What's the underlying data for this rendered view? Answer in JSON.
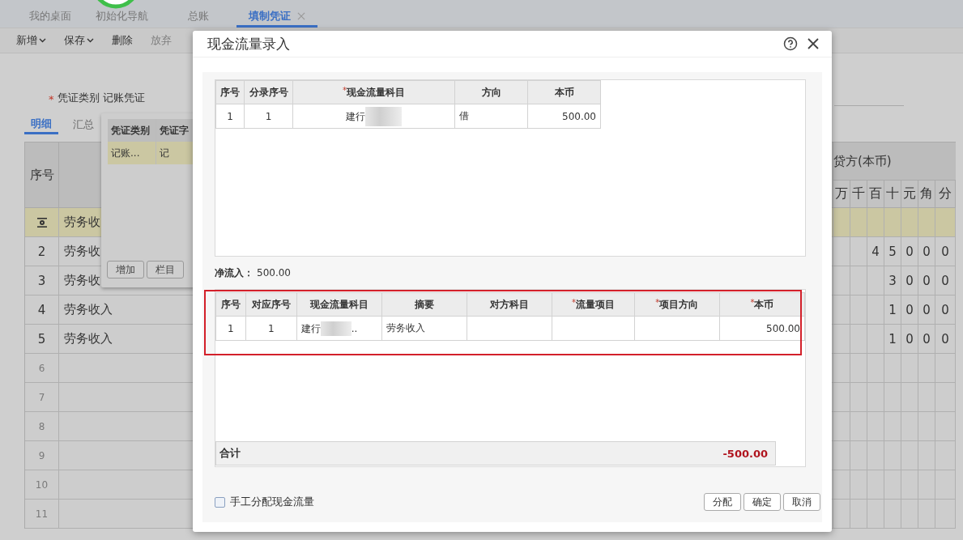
{
  "page_tabs": [
    {
      "label": "我的桌面",
      "selected": false,
      "closable": false
    },
    {
      "label": "初始化导航",
      "selected": false,
      "closable": false
    },
    {
      "label": "总账",
      "selected": false,
      "closable": false
    },
    {
      "label": "填制凭证",
      "selected": true,
      "closable": true
    }
  ],
  "toolbar": [
    {
      "label": "新增",
      "dropdown": true,
      "disabled": false
    },
    {
      "label": "保存",
      "dropdown": true,
      "disabled": false
    },
    {
      "label": "删除",
      "dropdown": false,
      "disabled": false
    },
    {
      "label": "放弃",
      "dropdown": false,
      "disabled": true
    }
  ],
  "voucher_type": {
    "mark": "*",
    "label": "凭证类别",
    "value": "记账凭证"
  },
  "detail_tabs": [
    {
      "label": "明细",
      "selected": true
    },
    {
      "label": "汇总",
      "selected": false
    }
  ],
  "voucher_table": {
    "columns": {
      "seq": "序号",
      "credit": "贷方(本币)",
      "digits": [
        "万",
        "千",
        "百",
        "十",
        "元",
        "角",
        "分"
      ]
    },
    "rows": [
      {
        "kind": "current",
        "summary": "劳务收",
        "selected": true,
        "empty": false
      },
      {
        "kind": "numbered",
        "seq": "2",
        "summary": "劳务收",
        "credit": [
          "4",
          "5",
          "0",
          "0",
          "0"
        ],
        "selected": false,
        "empty": false
      },
      {
        "kind": "numbered",
        "seq": "3",
        "summary": "劳务收",
        "credit": [
          "3",
          "0",
          "0",
          "0"
        ],
        "selected": false,
        "empty": false
      },
      {
        "kind": "numbered",
        "seq": "4",
        "summary": "劳务收入",
        "credit": [
          "1",
          "0",
          "0",
          "0"
        ],
        "selected": false,
        "empty": false
      },
      {
        "kind": "numbered",
        "seq": "5",
        "summary": "劳务收入",
        "credit": [
          "1",
          "0",
          "0",
          "0"
        ],
        "selected": false,
        "empty": false
      },
      {
        "kind": "numbered",
        "seq": "6",
        "selected": false,
        "empty": true
      },
      {
        "kind": "numbered",
        "seq": "7",
        "selected": false,
        "empty": true
      },
      {
        "kind": "numbered",
        "seq": "8",
        "selected": false,
        "empty": true
      },
      {
        "kind": "numbered",
        "seq": "9",
        "selected": false,
        "empty": true
      },
      {
        "kind": "numbered",
        "seq": "10",
        "selected": false,
        "empty": true
      },
      {
        "kind": "numbered",
        "seq": "11",
        "selected": false,
        "empty": true
      }
    ]
  },
  "type_popup": {
    "columns": [
      "凭证类别",
      "凭证字"
    ],
    "rows": [
      {
        "cells": [
          "记账...",
          "记"
        ],
        "selected": true
      }
    ],
    "buttons": [
      "增加",
      "栏目"
    ]
  },
  "dialog": {
    "title": "现金流量录入",
    "upper_table": {
      "columns": [
        {
          "label": "序号"
        },
        {
          "label": "分录序号"
        },
        {
          "mark": "*",
          "label": "现金流量科目"
        },
        {
          "label": "方向"
        },
        {
          "label": "本币"
        }
      ],
      "rows": [
        {
          "seq": "1",
          "entry_seq": "1",
          "account": {
            "text": "建行",
            "redacted": true
          },
          "direction": "借",
          "amount": "500.00"
        }
      ]
    },
    "net_inflow": {
      "label": "净流入：",
      "value": "500.00"
    },
    "lower_table": {
      "columns": [
        {
          "label": "序号"
        },
        {
          "label": "对应序号"
        },
        {
          "label": "现金流量科目"
        },
        {
          "label": "摘要"
        },
        {
          "label": "对方科目"
        },
        {
          "mark": "*",
          "label": "流量项目"
        },
        {
          "mark": "*",
          "label": "项目方向"
        },
        {
          "mark": "*",
          "label": "本币"
        }
      ],
      "rows": [
        {
          "seq": "1",
          "ref_seq": "1",
          "account": {
            "text": "建行",
            "redacted": true,
            "tail": ".."
          },
          "summary": "劳务收入",
          "amount": "500.00"
        }
      ],
      "total": {
        "label": "合计",
        "value": "-500.00"
      }
    },
    "manual_checkbox": {
      "label": "手工分配现金流量",
      "checked": false
    },
    "buttons": [
      "分配",
      "确定",
      "取消"
    ]
  }
}
